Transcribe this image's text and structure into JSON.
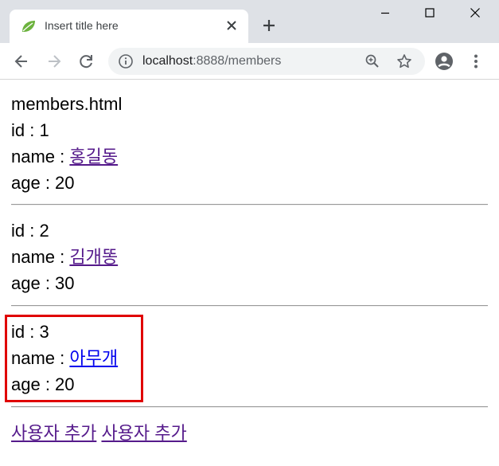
{
  "browser": {
    "tab_title": "Insert title here",
    "url_host": "localhost",
    "url_rest": ":8888/members"
  },
  "page": {
    "heading": "members.html",
    "labels": {
      "id": "id : ",
      "name": "name : ",
      "age": "age : "
    },
    "members": [
      {
        "id": "1",
        "name": " 홍길동",
        "age": "20"
      },
      {
        "id": "2",
        "name": " 김개똥",
        "age": "30"
      },
      {
        "id": "3",
        "name": " 아무개",
        "age": "20"
      }
    ],
    "links": [
      "사용자 추가",
      "사용자 추가"
    ]
  },
  "icons": {
    "favicon": "spring-leaf-icon",
    "close": "close-icon",
    "new_tab": "plus-icon",
    "back": "back-arrow-icon",
    "forward": "forward-arrow-icon",
    "reload": "reload-icon",
    "info": "info-icon",
    "zoom": "zoom-icon",
    "bookmark": "star-icon",
    "profile": "account-icon",
    "menu": "kebab-menu-icon"
  },
  "colors": {
    "highlight": "#e00000",
    "visited_link": "#551a8b",
    "unvisited_link": "#0000ee"
  }
}
